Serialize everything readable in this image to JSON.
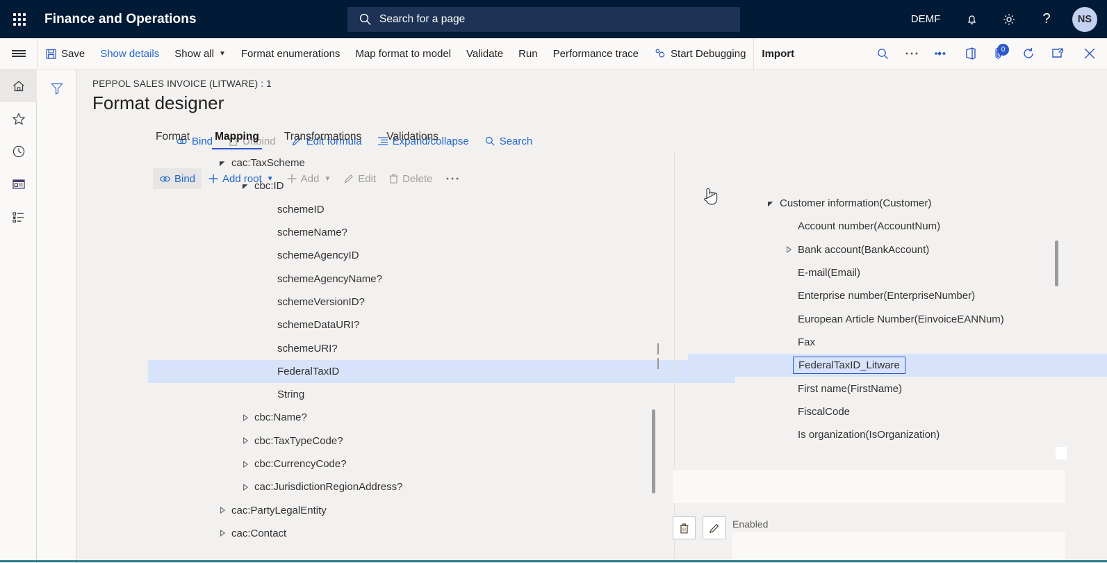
{
  "topbar": {
    "waffle_icon": "app-launcher-icon",
    "app_title": "Finance and Operations",
    "search": {
      "placeholder": "Search for a page",
      "icon": "search-icon"
    },
    "company": "DEMF",
    "notifications_icon": "bell-icon",
    "settings_icon": "gear-icon",
    "help_icon": "question-mark-icon",
    "avatar_initials": "NS"
  },
  "commandbar": {
    "menu_icon": "hamburger-icon",
    "save": {
      "label": "Save",
      "icon": "save-icon"
    },
    "show_details": "Show details",
    "show_all": "Show all",
    "format_enumerations": "Format enumerations",
    "map_format_to_model": "Map format to model",
    "validate": "Validate",
    "run": "Run",
    "performance_trace": "Performance trace",
    "start_debugging": {
      "label": "Start Debugging",
      "icon": "debug-icon"
    },
    "import": "Import",
    "icons": {
      "search": "search-icon",
      "overflow": "ellipsis-icon",
      "share": "share-icon",
      "office": "office-icon",
      "attachments": "attachment-icon",
      "refresh": "refresh-icon",
      "popout": "open-in-new-window-icon",
      "close": "close-icon"
    },
    "attachment_count": "0"
  },
  "rail": {
    "items": [
      {
        "name": "home-icon",
        "label": "Home",
        "active": true
      },
      {
        "name": "star-icon",
        "label": "Favorites",
        "active": false
      },
      {
        "name": "clock-icon",
        "label": "Recent",
        "active": false
      },
      {
        "name": "workspaces-icon",
        "label": "Workspaces",
        "active": false
      },
      {
        "name": "modules-icon",
        "label": "Modules",
        "active": false
      }
    ],
    "filter_icon": "filter-icon"
  },
  "page": {
    "breadcrumb": "PEPPOL SALES INVOICE (LITWARE) : 1",
    "title": "Format designer"
  },
  "format_toolbar": [
    {
      "label": "Bind",
      "icon": "bind-link-icon",
      "disabled": false
    },
    {
      "label": "Unbind",
      "icon": "trash-icon",
      "disabled": true
    },
    {
      "label": "Edit formula",
      "icon": "pencil-icon",
      "disabled": false
    },
    {
      "label": "Expand/collapse",
      "icon": "list-icon",
      "disabled": false
    },
    {
      "label": "Search",
      "icon": "search-icon",
      "disabled": false
    }
  ],
  "format_tree": [
    {
      "label": "cac:TaxScheme",
      "indent": 1,
      "twisty": "expanded",
      "selected": false
    },
    {
      "label": "cbc:ID",
      "indent": 2,
      "twisty": "expanded",
      "selected": false
    },
    {
      "label": "schemeID",
      "indent": 3,
      "twisty": "none",
      "selected": false
    },
    {
      "label": "schemeName?",
      "indent": 3,
      "twisty": "none",
      "selected": false
    },
    {
      "label": "schemeAgencyID",
      "indent": 3,
      "twisty": "none",
      "selected": false
    },
    {
      "label": "schemeAgencyName?",
      "indent": 3,
      "twisty": "none",
      "selected": false
    },
    {
      "label": "schemeVersionID?",
      "indent": 3,
      "twisty": "none",
      "selected": false
    },
    {
      "label": "schemeDataURI?",
      "indent": 3,
      "twisty": "none",
      "selected": false
    },
    {
      "label": "schemeURI?",
      "indent": 3,
      "twisty": "none",
      "selected": false
    },
    {
      "label": "FederalTaxID",
      "indent": 3,
      "twisty": "none",
      "selected": true
    },
    {
      "label": "String",
      "indent": 3,
      "twisty": "none",
      "selected": false
    },
    {
      "label": "cbc:Name?",
      "indent": 2,
      "twisty": "collapsed",
      "selected": false
    },
    {
      "label": "cbc:TaxTypeCode?",
      "indent": 2,
      "twisty": "collapsed",
      "selected": false
    },
    {
      "label": "cbc:CurrencyCode?",
      "indent": 2,
      "twisty": "collapsed",
      "selected": false
    },
    {
      "label": "cac:JurisdictionRegionAddress?",
      "indent": 2,
      "twisty": "collapsed",
      "selected": false
    },
    {
      "label": "cac:PartyLegalEntity",
      "indent": 1,
      "twisty": "collapsed",
      "selected": false
    },
    {
      "label": "cac:Contact",
      "indent": 1,
      "twisty": "collapsed",
      "selected": false
    }
  ],
  "right_tabs": [
    {
      "label": "Format",
      "active": false
    },
    {
      "label": "Mapping",
      "active": true
    },
    {
      "label": "Transformations",
      "active": false
    },
    {
      "label": "Validations",
      "active": false
    }
  ],
  "mapping_toolbar": [
    {
      "label": "Bind",
      "icon": "bind-link-icon",
      "disabled": false,
      "hovered": true,
      "dropdown": false
    },
    {
      "label": "Add root",
      "icon": "plus-icon",
      "disabled": false,
      "hovered": false,
      "dropdown": true
    },
    {
      "label": "Add",
      "icon": "plus-icon",
      "disabled": true,
      "hovered": false,
      "dropdown": true
    },
    {
      "label": "Edit",
      "icon": "pencil-icon",
      "disabled": true,
      "hovered": false,
      "dropdown": false
    },
    {
      "label": "Delete",
      "icon": "trash-icon",
      "disabled": true,
      "hovered": false,
      "dropdown": false
    },
    {
      "label": "···",
      "icon": "ellipsis-icon",
      "disabled": false,
      "hovered": false,
      "dropdown": false
    }
  ],
  "mapping_tree": [
    {
      "label": "Customer information(Customer)",
      "indent": 1,
      "twisty": "expanded",
      "selected": false,
      "boxed": false
    },
    {
      "label": "Account number(AccountNum)",
      "indent": 2,
      "twisty": "none",
      "selected": false,
      "boxed": false
    },
    {
      "label": "Bank account(BankAccount)",
      "indent": 2,
      "twisty": "collapsed",
      "selected": false,
      "boxed": false
    },
    {
      "label": "E-mail(Email)",
      "indent": 2,
      "twisty": "none",
      "selected": false,
      "boxed": false
    },
    {
      "label": "Enterprise number(EnterpriseNumber)",
      "indent": 2,
      "twisty": "none",
      "selected": false,
      "boxed": false
    },
    {
      "label": "European Article Number(EinvoiceEANNum)",
      "indent": 2,
      "twisty": "none",
      "selected": false,
      "boxed": false
    },
    {
      "label": "Fax",
      "indent": 2,
      "twisty": "none",
      "selected": false,
      "boxed": false
    },
    {
      "label": "FederalTaxID_Litware",
      "indent": 2,
      "twisty": "none",
      "selected": true,
      "boxed": true
    },
    {
      "label": "First name(FirstName)",
      "indent": 2,
      "twisty": "none",
      "selected": false,
      "boxed": false
    },
    {
      "label": "FiscalCode",
      "indent": 2,
      "twisty": "none",
      "selected": false,
      "boxed": false
    },
    {
      "label": "Is organization(IsOrganization)",
      "indent": 2,
      "twisty": "none",
      "selected": false,
      "boxed": false
    }
  ],
  "detail": {
    "delete_icon": "trash-icon",
    "edit_icon": "pencil-icon",
    "enabled_label": "Enabled",
    "enabled_value": ""
  },
  "colors": {
    "nav_background": "#011a35",
    "accent": "#2b57c9",
    "link": "#2266cc",
    "selection": "#d7e3fa",
    "page_background": "#f2f1f0",
    "command_background": "#faf9f8",
    "footer_accent": "#2a7b8c"
  }
}
